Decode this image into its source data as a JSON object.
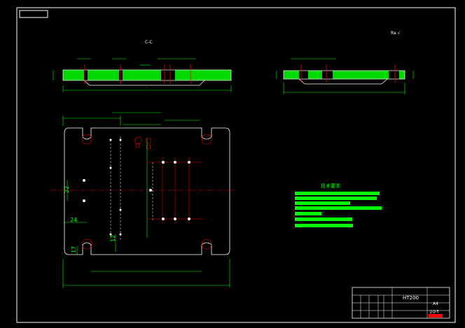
{
  "section_label": "C-C",
  "roughness_symbol": "Ra √",
  "dimensions": {
    "left_edge": "24",
    "mid_offset": "22",
    "bottom_left": "17",
    "inner_height": "12"
  },
  "tech_requirements": {
    "title": "技术要求",
    "line_numbers": [
      "1",
      "2",
      "3",
      "4",
      "5",
      "6"
    ]
  },
  "title_block": {
    "material": "HT200",
    "scale": "A4",
    "drawing_id": "JJ-JJ-5"
  },
  "colors": {
    "background": "#000000",
    "border": "#ffffff",
    "part_outline": "#ffffff",
    "section_fill": "#00ff00",
    "dimension": "#00ff00",
    "center_line": "#ff0000",
    "tech_text": "#00ff00",
    "title_id": "#ff0000"
  }
}
